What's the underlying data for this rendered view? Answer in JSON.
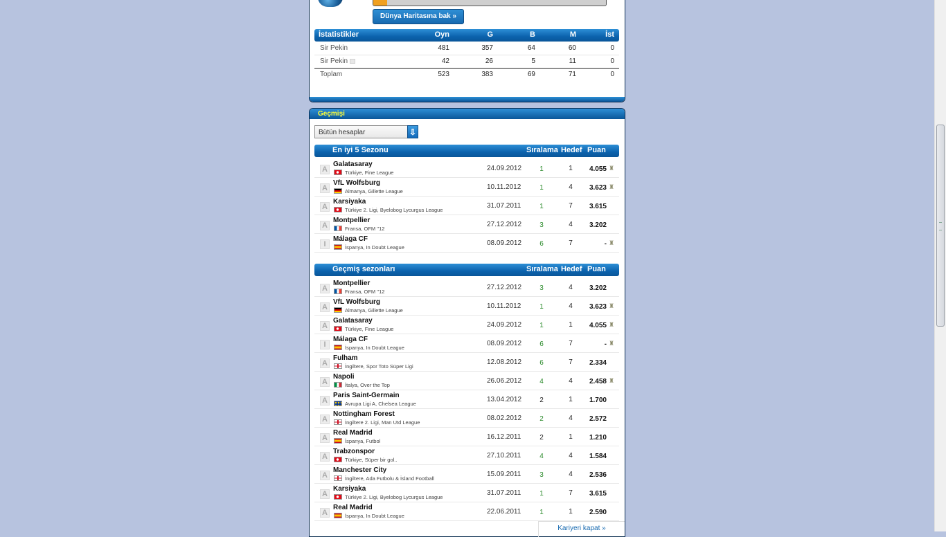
{
  "top_panel": {
    "progress": 0.06,
    "map_button": "Dünya Haritasına bak »"
  },
  "stats": {
    "headers": [
      "İstatistikler",
      "Oyn",
      "G",
      "B",
      "M",
      "İst"
    ],
    "rows": [
      {
        "name": "Sir Pekin",
        "values": [
          "481",
          "357",
          "64",
          "60",
          "0"
        ],
        "info": false
      },
      {
        "name": "Sir Pekin",
        "values": [
          "42",
          "26",
          "5",
          "11",
          "0"
        ],
        "info": true
      },
      {
        "name": "Toplam",
        "values": [
          "523",
          "383",
          "69",
          "71",
          "0"
        ],
        "info": false
      }
    ]
  },
  "history": {
    "title": "Geçmişi",
    "filter_value": "Bütün hesaplar",
    "best_seasons": {
      "headers": [
        "En iyi 5 Sezonu",
        "Sıralama",
        "Hedef",
        "Puan"
      ],
      "rows": [
        {
          "badge": "A",
          "team": "Galatasaray",
          "flag": "tr",
          "league": "Türkiye, Fine League",
          "date": "24.09.2012",
          "rank": "1",
          "rank_color": "green",
          "target": "1",
          "points": "4.055",
          "trophy": true
        },
        {
          "badge": "A",
          "team": "VfL Wolfsburg",
          "flag": "de",
          "league": "Almanya, Gillette League",
          "date": "10.11.2012",
          "rank": "1",
          "rank_color": "green",
          "target": "4",
          "points": "3.623",
          "trophy": true
        },
        {
          "badge": "A",
          "team": "Karsiyaka",
          "flag": "tr",
          "league": "Türkiye 2. Ligi, Byelobog Lycurgus League",
          "date": "31.07.2011",
          "rank": "1",
          "rank_color": "green",
          "target": "7",
          "points": "3.615",
          "trophy": false
        },
        {
          "badge": "A",
          "team": "Montpellier",
          "flag": "fr",
          "league": "Fransa, OFM ''12",
          "date": "27.12.2012",
          "rank": "3",
          "rank_color": "green",
          "target": "4",
          "points": "3.202",
          "trophy": false
        },
        {
          "badge": "I",
          "team": "Málaga CF",
          "flag": "es",
          "league": "İspanya, In Doubt League",
          "date": "08.09.2012",
          "rank": "6",
          "rank_color": "green",
          "target": "7",
          "points": "-",
          "trophy": true
        }
      ]
    },
    "past_seasons": {
      "headers": [
        "Geçmiş sezonları",
        "Sıralama",
        "Hedef",
        "Puan"
      ],
      "rows": [
        {
          "badge": "A",
          "team": "Montpellier",
          "flag": "fr",
          "league": "Fransa, OFM ''12",
          "date": "27.12.2012",
          "rank": "3",
          "rank_color": "green",
          "target": "4",
          "points": "3.202",
          "trophy": false
        },
        {
          "badge": "A",
          "team": "VfL Wolfsburg",
          "flag": "de",
          "league": "Almanya, Gillette League",
          "date": "10.11.2012",
          "rank": "1",
          "rank_color": "green",
          "target": "4",
          "points": "3.623",
          "trophy": true
        },
        {
          "badge": "A",
          "team": "Galatasaray",
          "flag": "tr",
          "league": "Türkiye, Fine League",
          "date": "24.09.2012",
          "rank": "1",
          "rank_color": "green",
          "target": "1",
          "points": "4.055",
          "trophy": true
        },
        {
          "badge": "I",
          "team": "Málaga CF",
          "flag": "es",
          "league": "İspanya, In Doubt League",
          "date": "08.09.2012",
          "rank": "6",
          "rank_color": "green",
          "target": "7",
          "points": "-",
          "trophy": true
        },
        {
          "badge": "A",
          "team": "Fulham",
          "flag": "en",
          "league": "İngiltere, Spor Toto Süper Ligi",
          "date": "12.08.2012",
          "rank": "6",
          "rank_color": "green",
          "target": "7",
          "points": "2.334",
          "trophy": false
        },
        {
          "badge": "A",
          "team": "Napoli",
          "flag": "it",
          "league": "İtalya, Over the Top",
          "date": "26.06.2012",
          "rank": "4",
          "rank_color": "green",
          "target": "4",
          "points": "2.458",
          "trophy": true
        },
        {
          "badge": "A",
          "team": "Paris Saint-Germain",
          "flag": "eu",
          "league": "Avrupa Ligi A, Chelsea League",
          "date": "13.04.2012",
          "rank": "2",
          "rank_color": "black",
          "target": "1",
          "points": "1.700",
          "trophy": false
        },
        {
          "badge": "A",
          "team": "Nottingham Forest",
          "flag": "en",
          "league": "İngiltere 2. Ligi, Man Utd League",
          "date": "08.02.2012",
          "rank": "2",
          "rank_color": "green",
          "target": "4",
          "points": "2.572",
          "trophy": false
        },
        {
          "badge": "A",
          "team": "Real Madrid",
          "flag": "es",
          "league": "İspanya, Futbol",
          "date": "16.12.2011",
          "rank": "2",
          "rank_color": "black",
          "target": "1",
          "points": "1.210",
          "trophy": false
        },
        {
          "badge": "A",
          "team": "Trabzonspor",
          "flag": "tr",
          "league": "Türkiye, Süper bir gol..",
          "date": "27.10.2011",
          "rank": "4",
          "rank_color": "green",
          "target": "4",
          "points": "1.584",
          "trophy": false
        },
        {
          "badge": "A",
          "team": "Manchester City",
          "flag": "en",
          "league": "İngiltere, Ada Futbolu & İsland Football",
          "date": "15.09.2011",
          "rank": "3",
          "rank_color": "green",
          "target": "4",
          "points": "2.536",
          "trophy": false
        },
        {
          "badge": "A",
          "team": "Karsiyaka",
          "flag": "tr",
          "league": "Türkiye 2. Ligi, Byelobog Lycurgus League",
          "date": "31.07.2011",
          "rank": "1",
          "rank_color": "green",
          "target": "7",
          "points": "3.615",
          "trophy": false
        },
        {
          "badge": "A",
          "team": "Real Madrid",
          "flag": "es",
          "league": "İspanya, In Doubt League",
          "date": "22.06.2011",
          "rank": "1",
          "rank_color": "green",
          "target": "1",
          "points": "2.590",
          "trophy": false
        }
      ]
    },
    "close_link": "Kariyeri kapat »"
  },
  "colors": {
    "accent_blue": "#0b62ad",
    "rank_green": "#2a8a2a",
    "title_yellow": "#ffff3a",
    "page_background": "#b7c3df"
  },
  "icons": {
    "trophy": "trophy-icon",
    "dropdown": "arrow-down-icon",
    "info": "info-icon"
  }
}
